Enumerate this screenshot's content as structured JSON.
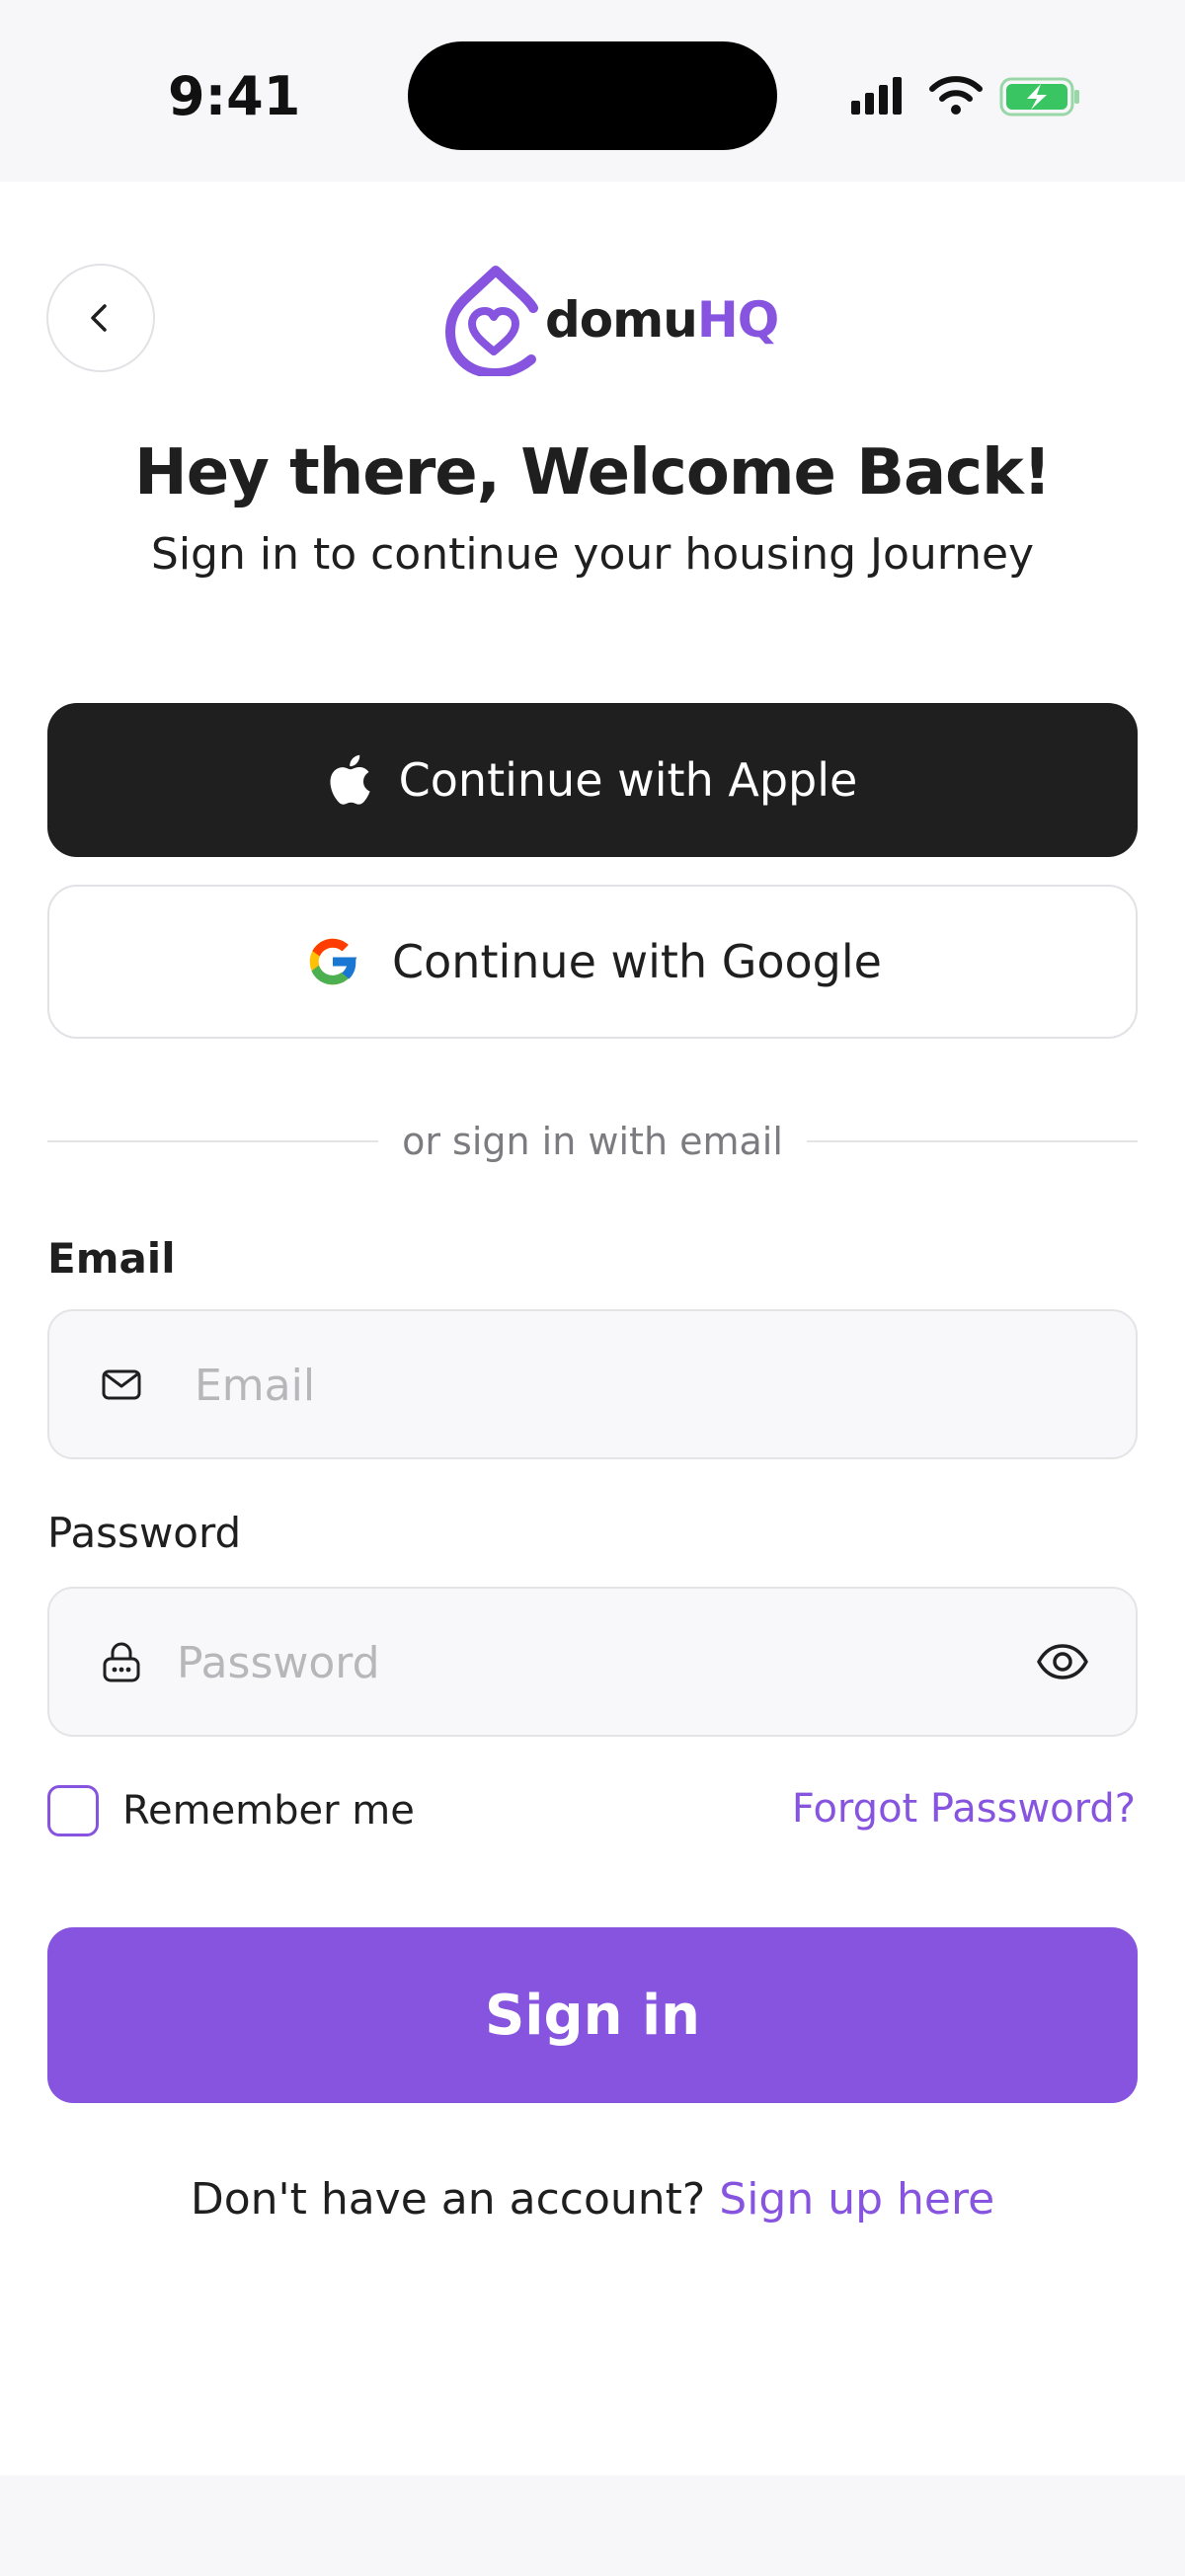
{
  "status_bar": {
    "time": "9:41"
  },
  "brand": {
    "name_part1": "domu",
    "name_part2": "HQ",
    "accent_color": "#8754e0"
  },
  "header": {
    "title": "Hey there, Welcome Back!",
    "subtitle": "Sign in to continue your housing Journey"
  },
  "social": {
    "apple_label": "Continue with Apple",
    "google_label": "Continue with Google"
  },
  "divider_text": "or sign in with email",
  "email": {
    "label": "Email",
    "placeholder": "Email",
    "value": ""
  },
  "password": {
    "label": "Password",
    "placeholder": "Password",
    "value": ""
  },
  "remember_me": {
    "label": "Remember me",
    "checked": false
  },
  "forgot_password_label": "Forgot Password?",
  "sign_in_label": "Sign in",
  "signup": {
    "prompt": "Don't have an account?",
    "link": "Sign up here"
  },
  "icons": {
    "back": "chevron-left-icon",
    "apple": "apple-icon",
    "google": "google-icon",
    "email": "mail-icon",
    "password": "lock-icon",
    "reveal": "eye-icon"
  }
}
